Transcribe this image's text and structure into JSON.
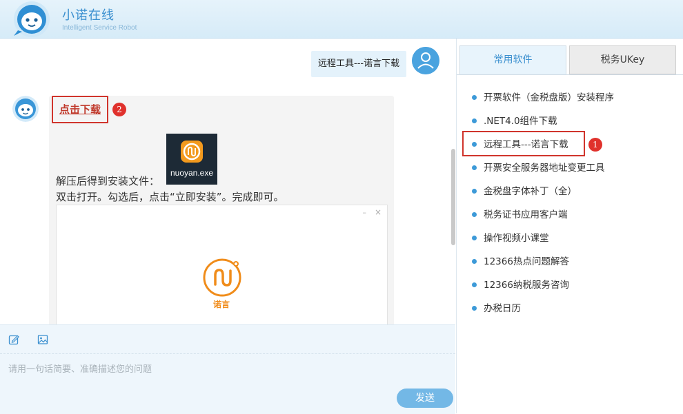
{
  "header": {
    "title": "小诺在线",
    "subtitle": "Intelligent Service Robot"
  },
  "chat": {
    "user_message": "远程工具---诺言下载",
    "bot": {
      "download_link": "点击下载",
      "link_badge": "2",
      "exe_name": "nuoyan.exe",
      "line1": "解压后得到安装文件：",
      "line2": "双击打开。勾选后，点击“立即安装”。完成即可。",
      "screenshot": {
        "minimize": "–",
        "close": "×",
        "app_name": "诺言"
      }
    }
  },
  "input": {
    "placeholder": "请用一句话简要、准确描述您的问题",
    "send_label": "发送"
  },
  "right_panel": {
    "tabs": [
      {
        "label": "常用软件",
        "active": true
      },
      {
        "label": "税务UKey",
        "active": false
      }
    ],
    "items": [
      {
        "label": "开票软件（金税盘版）安装程序"
      },
      {
        "label": ".NET4.0组件下载"
      },
      {
        "label": "远程工具---诺言下载",
        "highlighted": true
      },
      {
        "label": "开票安全服务器地址变更工具"
      },
      {
        "label": "金税盘字体补丁（全）"
      },
      {
        "label": "税务证书应用客户端"
      },
      {
        "label": "操作视频小课堂"
      },
      {
        "label": "12366热点问题解答"
      },
      {
        "label": "12366纳税服务咨询"
      },
      {
        "label": "办税日历"
      }
    ],
    "highlight_badge": "1"
  },
  "colors": {
    "accent": "#3a8fcf",
    "highlight_red": "#d0342c",
    "send_button": "#73b8e6"
  }
}
